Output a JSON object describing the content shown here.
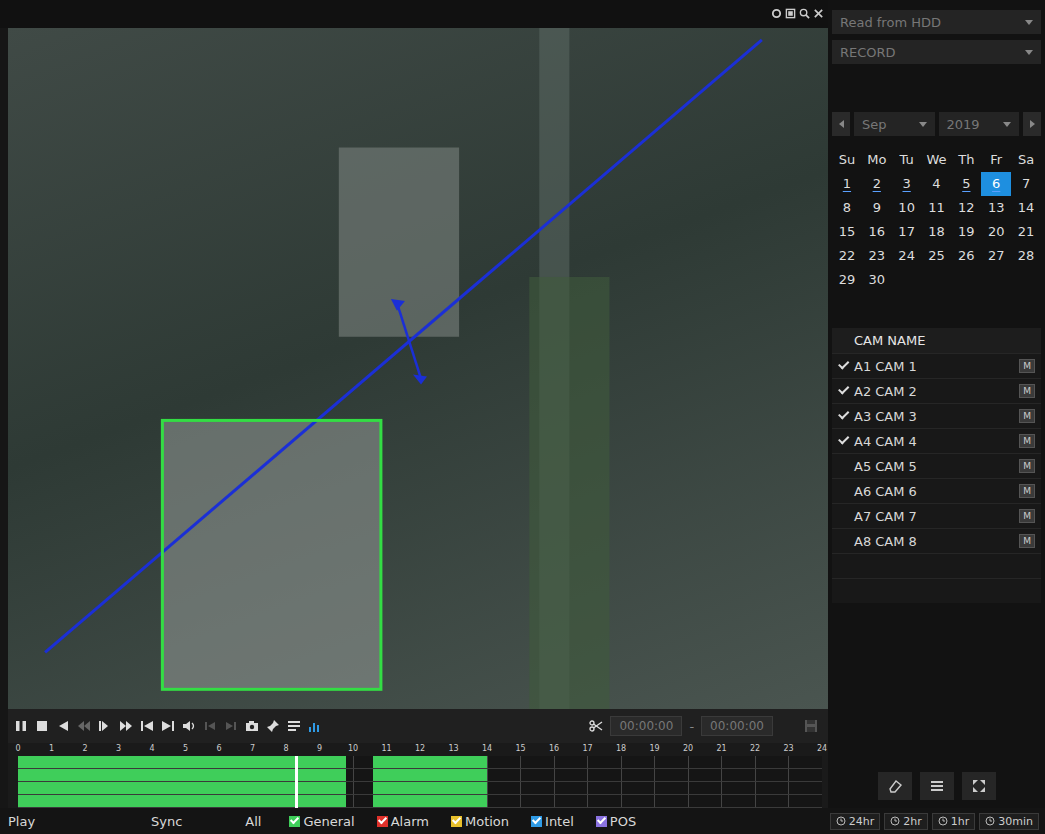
{
  "search_type": "Read from HDD",
  "record_type": "RECORD",
  "date": {
    "month": "Sep",
    "year": "2019"
  },
  "calendar": {
    "weekdays": [
      "Su",
      "Mo",
      "Tu",
      "We",
      "Th",
      "Fr",
      "Sa"
    ],
    "days": [
      {
        "day": "1",
        "record": true,
        "selected": false
      },
      {
        "day": "2",
        "record": true,
        "selected": false
      },
      {
        "day": "3",
        "record": true,
        "selected": false
      },
      {
        "day": "4",
        "record": false,
        "selected": false
      },
      {
        "day": "5",
        "record": true,
        "selected": false
      },
      {
        "day": "6",
        "record": true,
        "selected": true
      },
      {
        "day": "7",
        "record": false,
        "selected": false
      },
      {
        "day": "8",
        "record": false,
        "selected": false
      },
      {
        "day": "9",
        "record": false,
        "selected": false
      },
      {
        "day": "10",
        "record": false,
        "selected": false
      },
      {
        "day": "11",
        "record": false,
        "selected": false
      },
      {
        "day": "12",
        "record": false,
        "selected": false
      },
      {
        "day": "13",
        "record": false,
        "selected": false
      },
      {
        "day": "14",
        "record": false,
        "selected": false
      },
      {
        "day": "15",
        "record": false,
        "selected": false
      },
      {
        "day": "16",
        "record": false,
        "selected": false
      },
      {
        "day": "17",
        "record": false,
        "selected": false
      },
      {
        "day": "18",
        "record": false,
        "selected": false
      },
      {
        "day": "19",
        "record": false,
        "selected": false
      },
      {
        "day": "20",
        "record": false,
        "selected": false
      },
      {
        "day": "21",
        "record": false,
        "selected": false
      },
      {
        "day": "22",
        "record": false,
        "selected": false
      },
      {
        "day": "23",
        "record": false,
        "selected": false
      },
      {
        "day": "24",
        "record": false,
        "selected": false
      },
      {
        "day": "25",
        "record": false,
        "selected": false
      },
      {
        "day": "26",
        "record": false,
        "selected": false
      },
      {
        "day": "27",
        "record": false,
        "selected": false
      },
      {
        "day": "28",
        "record": false,
        "selected": false
      },
      {
        "day": "29",
        "record": false,
        "selected": false
      },
      {
        "day": "30",
        "record": false,
        "selected": false
      }
    ]
  },
  "camera_list": {
    "header": "CAM NAME",
    "header_checked": false,
    "cameras": [
      {
        "name": "A1 CAM 1",
        "checked": true,
        "badge": "M"
      },
      {
        "name": "A2 CAM 2",
        "checked": true,
        "badge": "M"
      },
      {
        "name": "A3 CAM 3",
        "checked": true,
        "badge": "M"
      },
      {
        "name": "A4 CAM 4",
        "checked": true,
        "badge": "M"
      },
      {
        "name": "A5 CAM 5",
        "checked": false,
        "badge": "M"
      },
      {
        "name": "A6 CAM 6",
        "checked": false,
        "badge": "M"
      },
      {
        "name": "A7 CAM 7",
        "checked": false,
        "badge": "M"
      },
      {
        "name": "A8 CAM 8",
        "checked": false,
        "badge": "M"
      }
    ]
  },
  "clip": {
    "start_time": "00:00:00",
    "separator": "-",
    "end_time": "00:00:00"
  },
  "timeline": {
    "hours": [
      "0",
      "1",
      "2",
      "3",
      "4",
      "5",
      "6",
      "7",
      "8",
      "9",
      "10",
      "11",
      "12",
      "13",
      "14",
      "15",
      "16",
      "17",
      "18",
      "19",
      "20",
      "21",
      "22",
      "23",
      "24"
    ],
    "cursor": 0.345,
    "rows": [
      {
        "segments": [
          {
            "start": 0,
            "end": 9.8,
            "color": "#3fce5a"
          },
          {
            "start": 10.6,
            "end": 14,
            "color": "#3fce5a"
          }
        ]
      },
      {
        "segments": [
          {
            "start": 0,
            "end": 9.8,
            "color": "#3fce5a"
          },
          {
            "start": 10.6,
            "end": 14,
            "color": "#3fce5a"
          }
        ]
      },
      {
        "segments": [
          {
            "start": 0,
            "end": 9.8,
            "color": "#3fce5a"
          },
          {
            "start": 10.6,
            "end": 14,
            "color": "#3fce5a"
          }
        ]
      },
      {
        "segments": [
          {
            "start": 0,
            "end": 9.8,
            "color": "#3fce5a"
          },
          {
            "start": 10.6,
            "end": 14,
            "color": "#3fce5a"
          }
        ]
      }
    ]
  },
  "status_bar": {
    "mode": "Play",
    "sync": {
      "label": "Sync",
      "checked": false
    },
    "all": {
      "label": "All",
      "checked": false
    },
    "legend": [
      {
        "label": "General",
        "color": "#3fce5a",
        "checked": true
      },
      {
        "label": "Alarm",
        "color": "#e0312b",
        "checked": true
      },
      {
        "label": "Motion",
        "color": "#e8c02c",
        "checked": true
      },
      {
        "label": "Intel",
        "color": "#2f9be6",
        "checked": true
      },
      {
        "label": "POS",
        "color": "#8a72e0",
        "checked": true
      }
    ],
    "scales": [
      {
        "label": "24hr",
        "selected": false
      },
      {
        "label": "2hr",
        "selected": false
      },
      {
        "label": "1hr",
        "selected": false
      },
      {
        "label": "30min",
        "selected": false
      }
    ]
  }
}
